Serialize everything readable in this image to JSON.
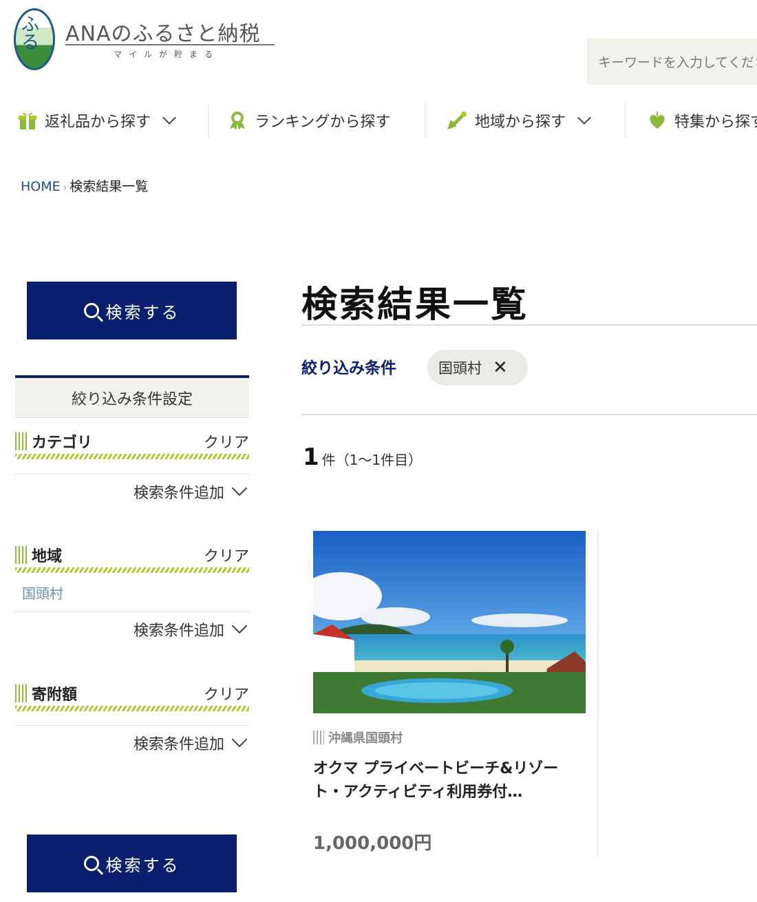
{
  "header": {
    "logo_mark": "ふる",
    "logo_title": "ANAのふるさと納税",
    "logo_sub": "マイルが貯まる",
    "search_placeholder": "キーワードを入力してください"
  },
  "nav": {
    "items": [
      {
        "label": "返礼品から探す",
        "icon": "gift-icon",
        "has_dropdown": true
      },
      {
        "label": "ランキングから探す",
        "icon": "award-icon",
        "has_dropdown": false
      },
      {
        "label": "地域から探す",
        "icon": "map-pin-icon",
        "has_dropdown": true
      },
      {
        "label": "特集から探す",
        "icon": "heart-icon",
        "has_dropdown": false
      }
    ]
  },
  "breadcrumb": {
    "home": "HOME",
    "separator": "›",
    "current": "検索結果一覧"
  },
  "sidebar": {
    "search_button": "検索する",
    "panel_title": "絞り込み条件設定",
    "sections": [
      {
        "title": "カテゴリ",
        "clear": "クリア",
        "add": "検索条件追加"
      },
      {
        "title": "地域",
        "clear": "クリア",
        "selected": "国頭村",
        "add": "検索条件追加"
      },
      {
        "title": "寄附額",
        "clear": "クリア",
        "add": "検索条件追加"
      }
    ]
  },
  "main": {
    "title": "検索結果一覧",
    "filter_label": "絞り込み条件",
    "filter_chip": "国頭村",
    "count_number": "1",
    "count_text": "件（1〜1件目）",
    "item": {
      "region": "沖縄県国頭村",
      "title": "オクマ プライベートビーチ&リゾート・アクティビティ利用券付…",
      "price": "1,000,000円"
    }
  },
  "colors": {
    "brand_navy": "#0a1f6e",
    "accent_green": "#a9cc2c",
    "link_blue": "#1a4c8b"
  }
}
